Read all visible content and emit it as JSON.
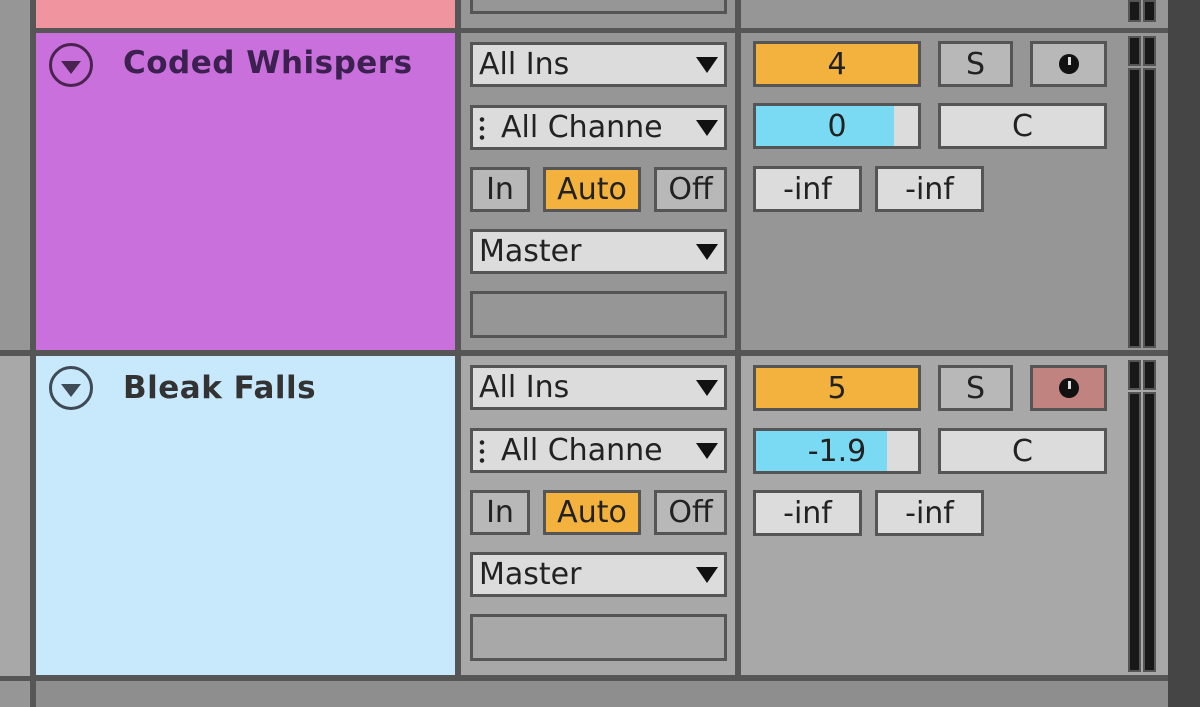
{
  "colors": {
    "prev_track": "#f0959f",
    "track1": "#c970dc",
    "track2": "#c8e8fb",
    "accent_orange": "#f3b13d",
    "volume_blue": "#7bdaf3",
    "solo_armed_red": "#c0837f"
  },
  "tracks": [
    {
      "name": "Coded Whispers",
      "fold_icon": "fold-triangle-icon",
      "input_type": "All Ins",
      "input_channel": "All Channels",
      "input_channel_display": "All Channe",
      "monitor": {
        "in": "In",
        "auto": "Auto",
        "off": "Off",
        "active": "Auto"
      },
      "output": "Master",
      "track_number": "4",
      "solo": "S",
      "arm_icon": "record-arm-clock-icon",
      "arm_active": false,
      "volume": "0",
      "volume_fraction": 0.85,
      "pan": "C",
      "peak_left": "-inf",
      "peak_right": "-inf"
    },
    {
      "name": "Bleak Falls",
      "fold_icon": "fold-triangle-icon",
      "input_type": "All Ins",
      "input_channel": "All Channels",
      "input_channel_display": "All Channe",
      "monitor": {
        "in": "In",
        "auto": "Auto",
        "off": "Off",
        "active": "Auto"
      },
      "output": "Master",
      "track_number": "5",
      "solo": "S",
      "arm_icon": "record-arm-clock-icon",
      "arm_active": true,
      "volume": "-1.9",
      "volume_fraction": 0.81,
      "pan": "C",
      "peak_left": "-inf",
      "peak_right": "-inf"
    }
  ]
}
